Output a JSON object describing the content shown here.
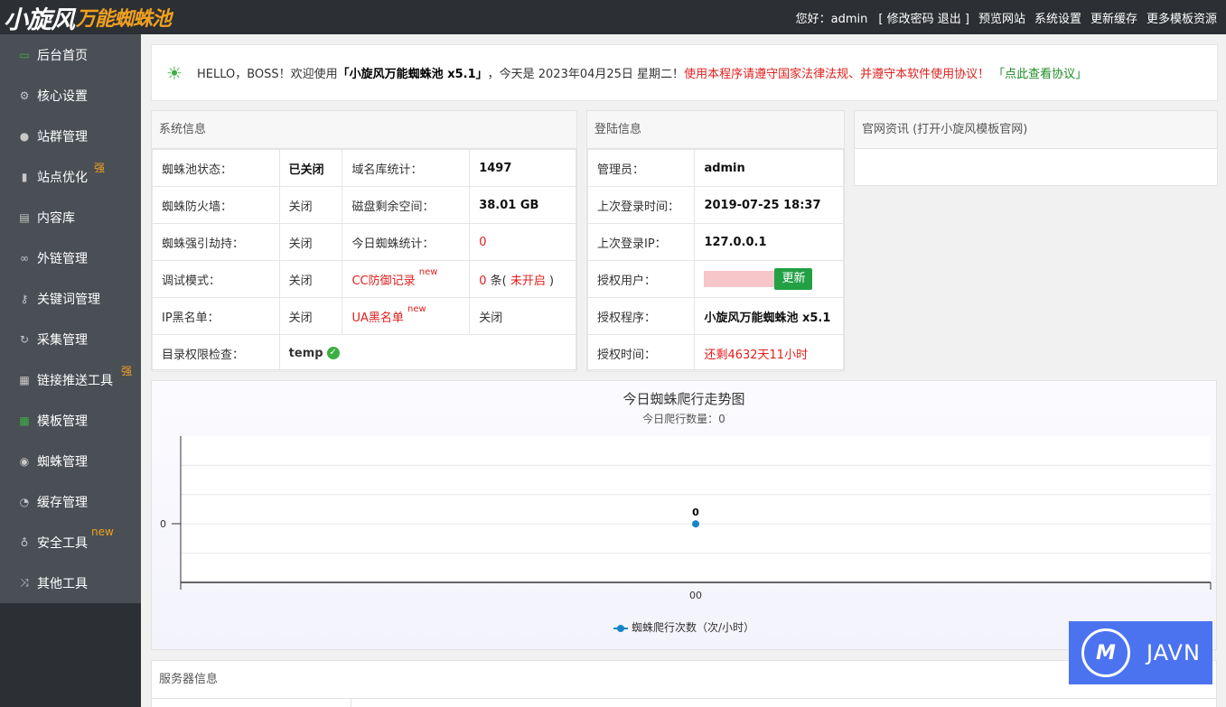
{
  "app": {
    "logo_main": "小旋风",
    "logo_sub": "万能蜘蛛池"
  },
  "topnav": {
    "greeting": "您好：admin",
    "account_links": "[ 修改密码 退出 ]",
    "preview": "预览网站",
    "settings": "系统设置",
    "update_cache": "更新缓存",
    "more_templates": "更多模板资源"
  },
  "sidebar": {
    "items": [
      {
        "label": "后台首页",
        "icon": "monitor-icon",
        "sup": ""
      },
      {
        "label": "核心设置",
        "icon": "gear-icon",
        "sup": ""
      },
      {
        "label": "站群管理",
        "icon": "user-icon",
        "sup": ""
      },
      {
        "label": "站点优化",
        "icon": "bar-chart-icon",
        "sup": "强"
      },
      {
        "label": "内容库",
        "icon": "document-icon",
        "sup": ""
      },
      {
        "label": "外链管理",
        "icon": "link-icon",
        "sup": ""
      },
      {
        "label": "关键词管理",
        "icon": "key-icon",
        "sup": ""
      },
      {
        "label": "采集管理",
        "icon": "refresh-icon",
        "sup": ""
      },
      {
        "label": "链接推送工具",
        "icon": "windows-icon",
        "sup": "强"
      },
      {
        "label": "模板管理",
        "icon": "grid-icon",
        "sup": ""
      },
      {
        "label": "蜘蛛管理",
        "icon": "android-icon",
        "sup": ""
      },
      {
        "label": "缓存管理",
        "icon": "stopwatch-icon",
        "sup": ""
      },
      {
        "label": "安全工具",
        "icon": "lightbulb-icon",
        "sup": "new"
      },
      {
        "label": "其他工具",
        "icon": "shuffle-icon",
        "sup": ""
      }
    ]
  },
  "notice": {
    "hello": "HELLO，BOSS！欢迎使用",
    "product": "「小旋风万能蜘蛛池 x5.1」",
    "date_text": "，今天是 2023年04月25日 星期二！",
    "warning": "使用本程序请遵守国家法律法规、并遵守本软件使用协议！",
    "agreement_link": "「点此查看协议」"
  },
  "system_info": {
    "title": "系统信息",
    "rows": [
      {
        "k1": "蜘蛛池状态：",
        "v1": "已关闭",
        "k2": "域名库统计：",
        "v2": "1497"
      },
      {
        "k1": "蜘蛛防火墙：",
        "v1": "关闭",
        "k2": "磁盘剩余空间：",
        "v2": "38.01 GB"
      },
      {
        "k1": "蜘蛛强引劫持：",
        "v1": "关闭",
        "k2": "今日蜘蛛统计：",
        "v2": "0"
      },
      {
        "k1": "调试模式：",
        "v1": "关闭",
        "k2": "CC防御记录",
        "k2_sup": "new",
        "v2": "0",
        "v2_suffix": " 条(",
        "v2_status": " 未开启 ",
        "v2_close": ")"
      },
      {
        "k1": "IP黑名单：",
        "v1": "关闭",
        "k2": "UA黑名单",
        "k2_sup": "new",
        "v2": "关闭"
      },
      {
        "k1": "目录权限检查：",
        "v1": "temp"
      }
    ]
  },
  "login_info": {
    "title": "登陆信息",
    "rows": [
      {
        "k": "管理员：",
        "v": "admin"
      },
      {
        "k": "上次登录时间：",
        "v": "2019-07-25 18:37"
      },
      {
        "k": "上次登录IP：",
        "v": "127.0.0.1"
      },
      {
        "k": "授权用户：",
        "v": "",
        "button": "更新"
      },
      {
        "k": "授权程序：",
        "v": "小旋风万能蜘蛛池 x5.1"
      },
      {
        "k": "授权时间：",
        "v": "还剩4632天11小时"
      }
    ]
  },
  "news": {
    "title": "官网资讯 (打开小旋风模板官网)"
  },
  "chart_data": {
    "type": "line",
    "title": "今日蜘蛛爬行走势图",
    "subtitle": "今日爬行数量：0",
    "categories": [
      "00"
    ],
    "series": [
      {
        "name": "蜘蛛爬行次数（次/小时）",
        "values": [
          0
        ]
      }
    ],
    "y_ticks": [
      "0"
    ],
    "grid": true,
    "legend": "bottom",
    "color": "#1585c8"
  },
  "server_info": {
    "title": "服务器信息"
  },
  "watermark": {
    "text": "JAVN"
  }
}
